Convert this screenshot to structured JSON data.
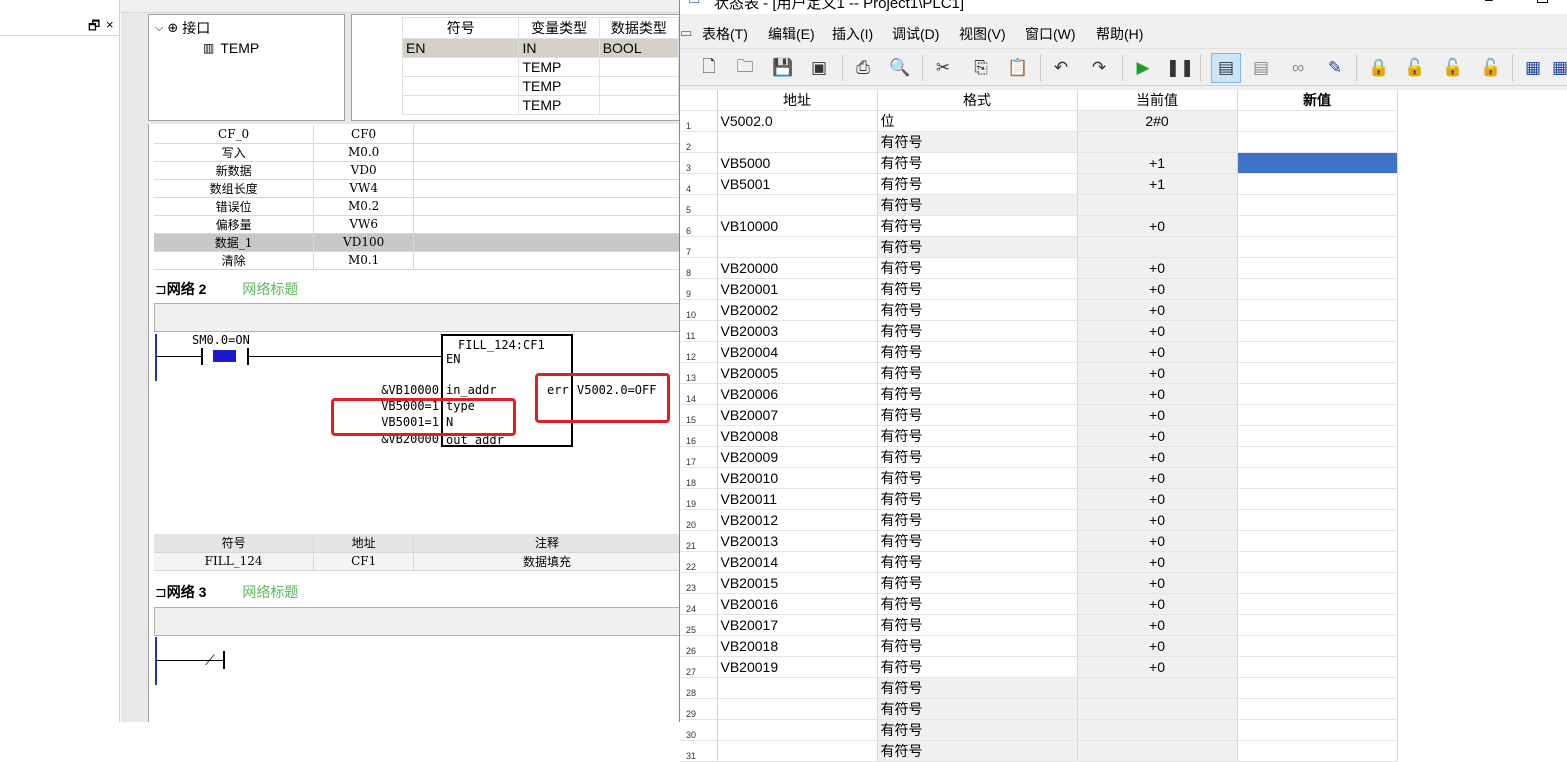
{
  "left_panel": {
    "dock_icon": "restore-window-icon",
    "close_label": "×"
  },
  "tree": {
    "root_label": "接口",
    "child_label": "TEMP"
  },
  "iface": {
    "headers": [
      "符号",
      "变量类型",
      "数据类型"
    ],
    "rows": [
      {
        "symbol": "EN",
        "var_type": "IN",
        "data_type": "BOOL"
      },
      {
        "symbol": "",
        "var_type": "TEMP",
        "data_type": ""
      },
      {
        "symbol": "",
        "var_type": "TEMP",
        "data_type": ""
      },
      {
        "symbol": "",
        "var_type": "TEMP",
        "data_type": ""
      }
    ]
  },
  "symbols_top": [
    [
      "CF_0",
      "CF0"
    ],
    [
      "写入",
      "M0.0"
    ],
    [
      "新数据",
      "VD0"
    ],
    [
      "数组长度",
      "VW4"
    ],
    [
      "错误位",
      "M0.2"
    ],
    [
      "偏移量",
      "VW6"
    ],
    [
      "数据_1",
      "VD100"
    ],
    [
      "清除",
      "M0.1"
    ]
  ],
  "network2": {
    "label": "网络 2",
    "title": "网络标题"
  },
  "ladder": {
    "contact_label": "SM0.0=ON",
    "block_title": "FILL_124:CF1",
    "en": "EN",
    "in_addr_value": "&VB10000",
    "in_addr": "in_addr",
    "type_value": "VB5000=1",
    "type": "type",
    "n_value": "VB5001=1",
    "n": "N",
    "out_addr_value": "&VB20000",
    "out_addr": "out_addr",
    "err": "err",
    "err_value": "V5002.0=OFF"
  },
  "symbols_bottom": {
    "headers": [
      "符号",
      "地址",
      "注释"
    ],
    "row": [
      "FILL_124",
      "CF1",
      "数据填充"
    ]
  },
  "network3": {
    "label": "网络 3",
    "title": "网络标题"
  },
  "window": {
    "title": "状态表 - [用户定义1 -- Project1\\PLC1]"
  },
  "menu": [
    "表格(T)",
    "编辑(E)",
    "插入(I)",
    "调试(D)",
    "视图(V)",
    "窗口(W)",
    "帮助(H)"
  ],
  "toolbar_icons": [
    "new-file-icon",
    "open-folder-icon",
    "save-icon",
    "save-all-icon",
    "print-icon",
    "print-preview-icon",
    "cut-icon",
    "copy-icon",
    "paste-icon",
    "undo-icon",
    "redo-icon",
    "run-icon",
    "pause-icon",
    "chart-status-icon",
    "single-read-icon",
    "glasses-icon",
    "write-icon",
    "lock-icon",
    "unlock-icon",
    "force-icon",
    "unforce-icon",
    "table-icon",
    "trend-icon"
  ],
  "status_table": {
    "headers": [
      "地址",
      "格式",
      "当前值",
      "新值"
    ],
    "rows": [
      {
        "n": "1",
        "addr": "V5002.0",
        "fmt": "位",
        "cur": "2#0"
      },
      {
        "n": "2",
        "addr": "",
        "fmt": "有符号",
        "cur": ""
      },
      {
        "n": "3",
        "addr": "VB5000",
        "fmt": "有符号",
        "cur": "+1"
      },
      {
        "n": "4",
        "addr": "VB5001",
        "fmt": "有符号",
        "cur": "+1"
      },
      {
        "n": "5",
        "addr": "",
        "fmt": "有符号",
        "cur": ""
      },
      {
        "n": "6",
        "addr": "VB10000",
        "fmt": "有符号",
        "cur": "+0"
      },
      {
        "n": "7",
        "addr": "",
        "fmt": "有符号",
        "cur": ""
      },
      {
        "n": "8",
        "addr": "VB20000",
        "fmt": "有符号",
        "cur": "+0"
      },
      {
        "n": "9",
        "addr": "VB20001",
        "fmt": "有符号",
        "cur": "+0"
      },
      {
        "n": "10",
        "addr": "VB20002",
        "fmt": "有符号",
        "cur": "+0"
      },
      {
        "n": "11",
        "addr": "VB20003",
        "fmt": "有符号",
        "cur": "+0"
      },
      {
        "n": "12",
        "addr": "VB20004",
        "fmt": "有符号",
        "cur": "+0"
      },
      {
        "n": "13",
        "addr": "VB20005",
        "fmt": "有符号",
        "cur": "+0"
      },
      {
        "n": "14",
        "addr": "VB20006",
        "fmt": "有符号",
        "cur": "+0"
      },
      {
        "n": "15",
        "addr": "VB20007",
        "fmt": "有符号",
        "cur": "+0"
      },
      {
        "n": "16",
        "addr": "VB20008",
        "fmt": "有符号",
        "cur": "+0"
      },
      {
        "n": "17",
        "addr": "VB20009",
        "fmt": "有符号",
        "cur": "+0"
      },
      {
        "n": "18",
        "addr": "VB20010",
        "fmt": "有符号",
        "cur": "+0"
      },
      {
        "n": "19",
        "addr": "VB20011",
        "fmt": "有符号",
        "cur": "+0"
      },
      {
        "n": "20",
        "addr": "VB20012",
        "fmt": "有符号",
        "cur": "+0"
      },
      {
        "n": "21",
        "addr": "VB20013",
        "fmt": "有符号",
        "cur": "+0"
      },
      {
        "n": "22",
        "addr": "VB20014",
        "fmt": "有符号",
        "cur": "+0"
      },
      {
        "n": "23",
        "addr": "VB20015",
        "fmt": "有符号",
        "cur": "+0"
      },
      {
        "n": "24",
        "addr": "VB20016",
        "fmt": "有符号",
        "cur": "+0"
      },
      {
        "n": "25",
        "addr": "VB20017",
        "fmt": "有符号",
        "cur": "+0"
      },
      {
        "n": "26",
        "addr": "VB20018",
        "fmt": "有符号",
        "cur": "+0"
      },
      {
        "n": "27",
        "addr": "VB20019",
        "fmt": "有符号",
        "cur": "+0"
      },
      {
        "n": "28",
        "addr": "",
        "fmt": "有符号",
        "cur": ""
      },
      {
        "n": "29",
        "addr": "",
        "fmt": "有符号",
        "cur": ""
      },
      {
        "n": "30",
        "addr": "",
        "fmt": "有符号",
        "cur": ""
      },
      {
        "n": "31",
        "addr": "",
        "fmt": "有符号",
        "cur": ""
      }
    ]
  },
  "colors": {
    "selection": "#3e74c8",
    "highlight_box": "#e02020",
    "network_title": "#5cb85c",
    "contact_fill": "#1a1acc"
  }
}
